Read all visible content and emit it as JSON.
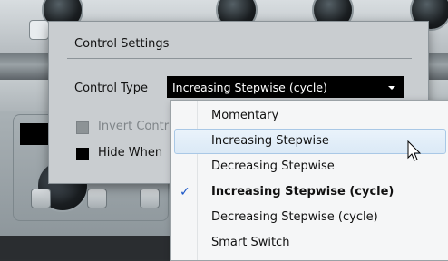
{
  "dialog": {
    "title": "Control Settings",
    "control_type_label": "Control Type",
    "control_type_value": "Increasing Stepwise (cycle)",
    "invert_label": "Invert Contr",
    "hide_label": "Hide When"
  },
  "menu": {
    "items": [
      {
        "label": "Momentary"
      },
      {
        "label": "Increasing Stepwise"
      },
      {
        "label": "Decreasing Stepwise"
      },
      {
        "label": "Increasing Stepwise (cycle)"
      },
      {
        "label": "Decreasing Stepwise (cycle)"
      },
      {
        "label": "Smart Switch"
      }
    ],
    "check_glyph": "✓",
    "hovered_index": 1,
    "selected_index": 3
  },
  "colors": {
    "dialog_bg": "#c9cdd0",
    "select_bg": "#000000",
    "check": "#1a56c7",
    "hover_bg": "#dbe9f6"
  }
}
